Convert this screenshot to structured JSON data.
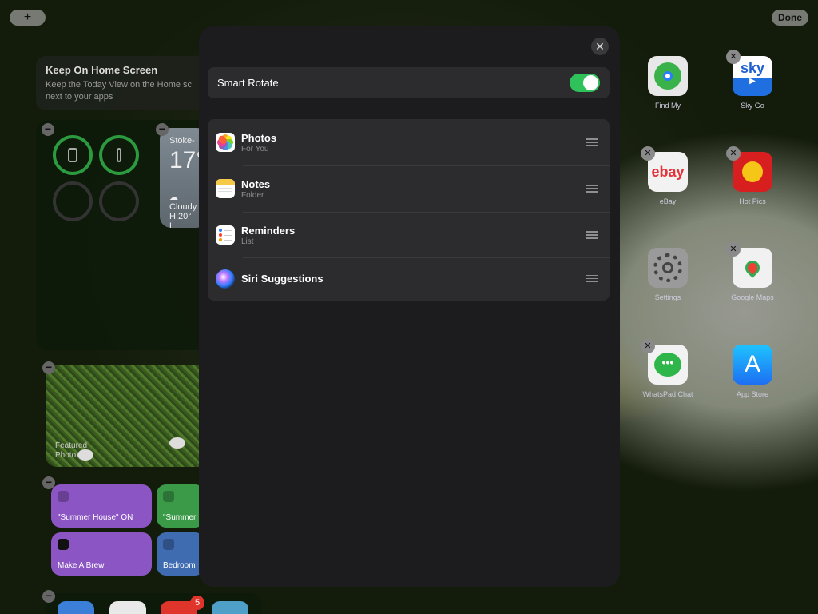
{
  "top_bar": {
    "add_label": "+",
    "done_label": "Done"
  },
  "today_view": {
    "keep_title": "Keep On Home Screen",
    "keep_subtitle_line1": "Keep the Today View on the Home sc",
    "keep_subtitle_line2": "next to your apps",
    "weather_city": "Stoke-",
    "weather_temp": "17°",
    "weather_condition": "Cloudy",
    "weather_hilo": "H:20° L",
    "photo_label": "Featured Photo",
    "shortcuts": [
      {
        "label": "\"Summer House\" ON"
      },
      {
        "label": "\"Summer"
      },
      {
        "label": "Make A Brew"
      },
      {
        "label": "Bedroom"
      }
    ],
    "badge_count": "5"
  },
  "apps": [
    {
      "name": "Find My"
    },
    {
      "name": "Sky Go",
      "glyph": "sky"
    },
    {
      "name": "eBay",
      "glyph": "ebay"
    },
    {
      "name": "Hot Pics"
    },
    {
      "name": "Settings"
    },
    {
      "name": "Google Maps"
    },
    {
      "name": "WhatsPad Chat"
    },
    {
      "name": "App Store"
    }
  ],
  "modal": {
    "close_glyph": "✕",
    "smart_rotate_label": "Smart Rotate",
    "smart_rotate_on": true,
    "widgets": [
      {
        "title": "Photos",
        "subtitle": "For You",
        "icon": "photos-icon"
      },
      {
        "title": "Notes",
        "subtitle": "Folder",
        "icon": "notes-icon"
      },
      {
        "title": "Reminders",
        "subtitle": "List",
        "icon": "reminders-icon"
      },
      {
        "title": "Siri Suggestions",
        "subtitle": "",
        "icon": "siri-icon"
      }
    ]
  },
  "colors": {
    "toggle_on": "#30c25a",
    "modal_bg": "#1c1c1e",
    "row_bg": "#2c2c2e"
  }
}
